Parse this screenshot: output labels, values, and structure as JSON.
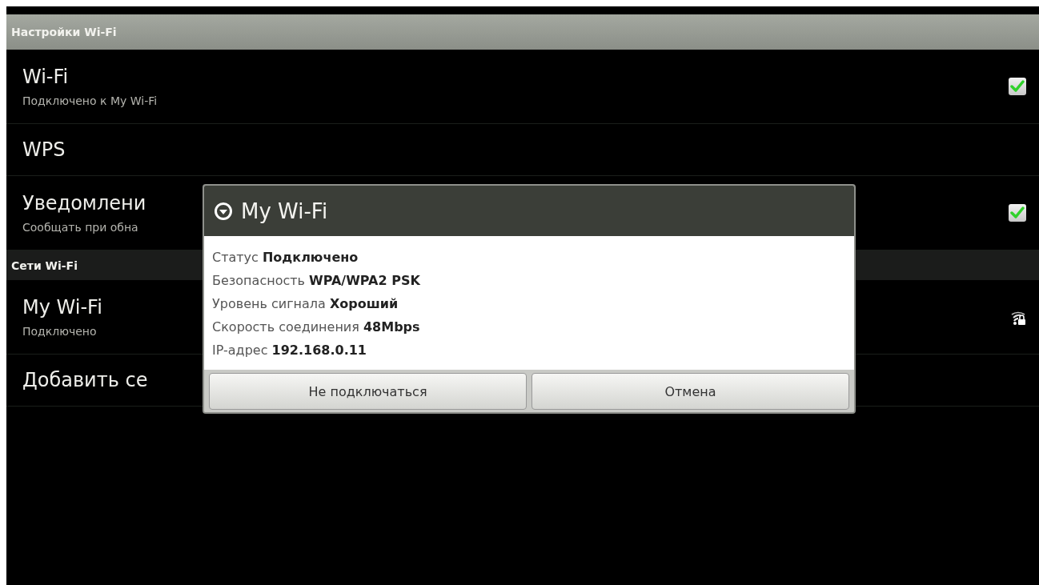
{
  "header": {
    "title": "Настройки Wi-Fi"
  },
  "settings": [
    {
      "kind": "toggle",
      "title": "Wi-Fi",
      "subtitle": "Подключено к My Wi-Fi",
      "checked": true
    },
    {
      "kind": "plain",
      "title": "WPS"
    },
    {
      "kind": "toggle",
      "title": "Уведомлени",
      "subtitle": "Сообщать при обна",
      "checked": true
    }
  ],
  "networks_header": {
    "title": "Сети Wi-Fi"
  },
  "networks": [
    {
      "kind": "network",
      "title": "My Wi-Fi",
      "subtitle": "Подключено"
    },
    {
      "kind": "plain",
      "title": "Добавить се"
    }
  ],
  "dialog": {
    "title": "My Wi-Fi",
    "details": [
      {
        "label": "Статус",
        "value": "Подключено"
      },
      {
        "label": "Безопасность",
        "value": "WPA/WPA2 PSK"
      },
      {
        "label": "Уровень сигнала",
        "value": "Хороший"
      },
      {
        "label": "Скорость соединения",
        "value": "48Mbps"
      },
      {
        "label": "IP-адрес",
        "value": "192.168.0.11"
      }
    ],
    "buttons": [
      "Не подключаться",
      "Отмена"
    ]
  }
}
